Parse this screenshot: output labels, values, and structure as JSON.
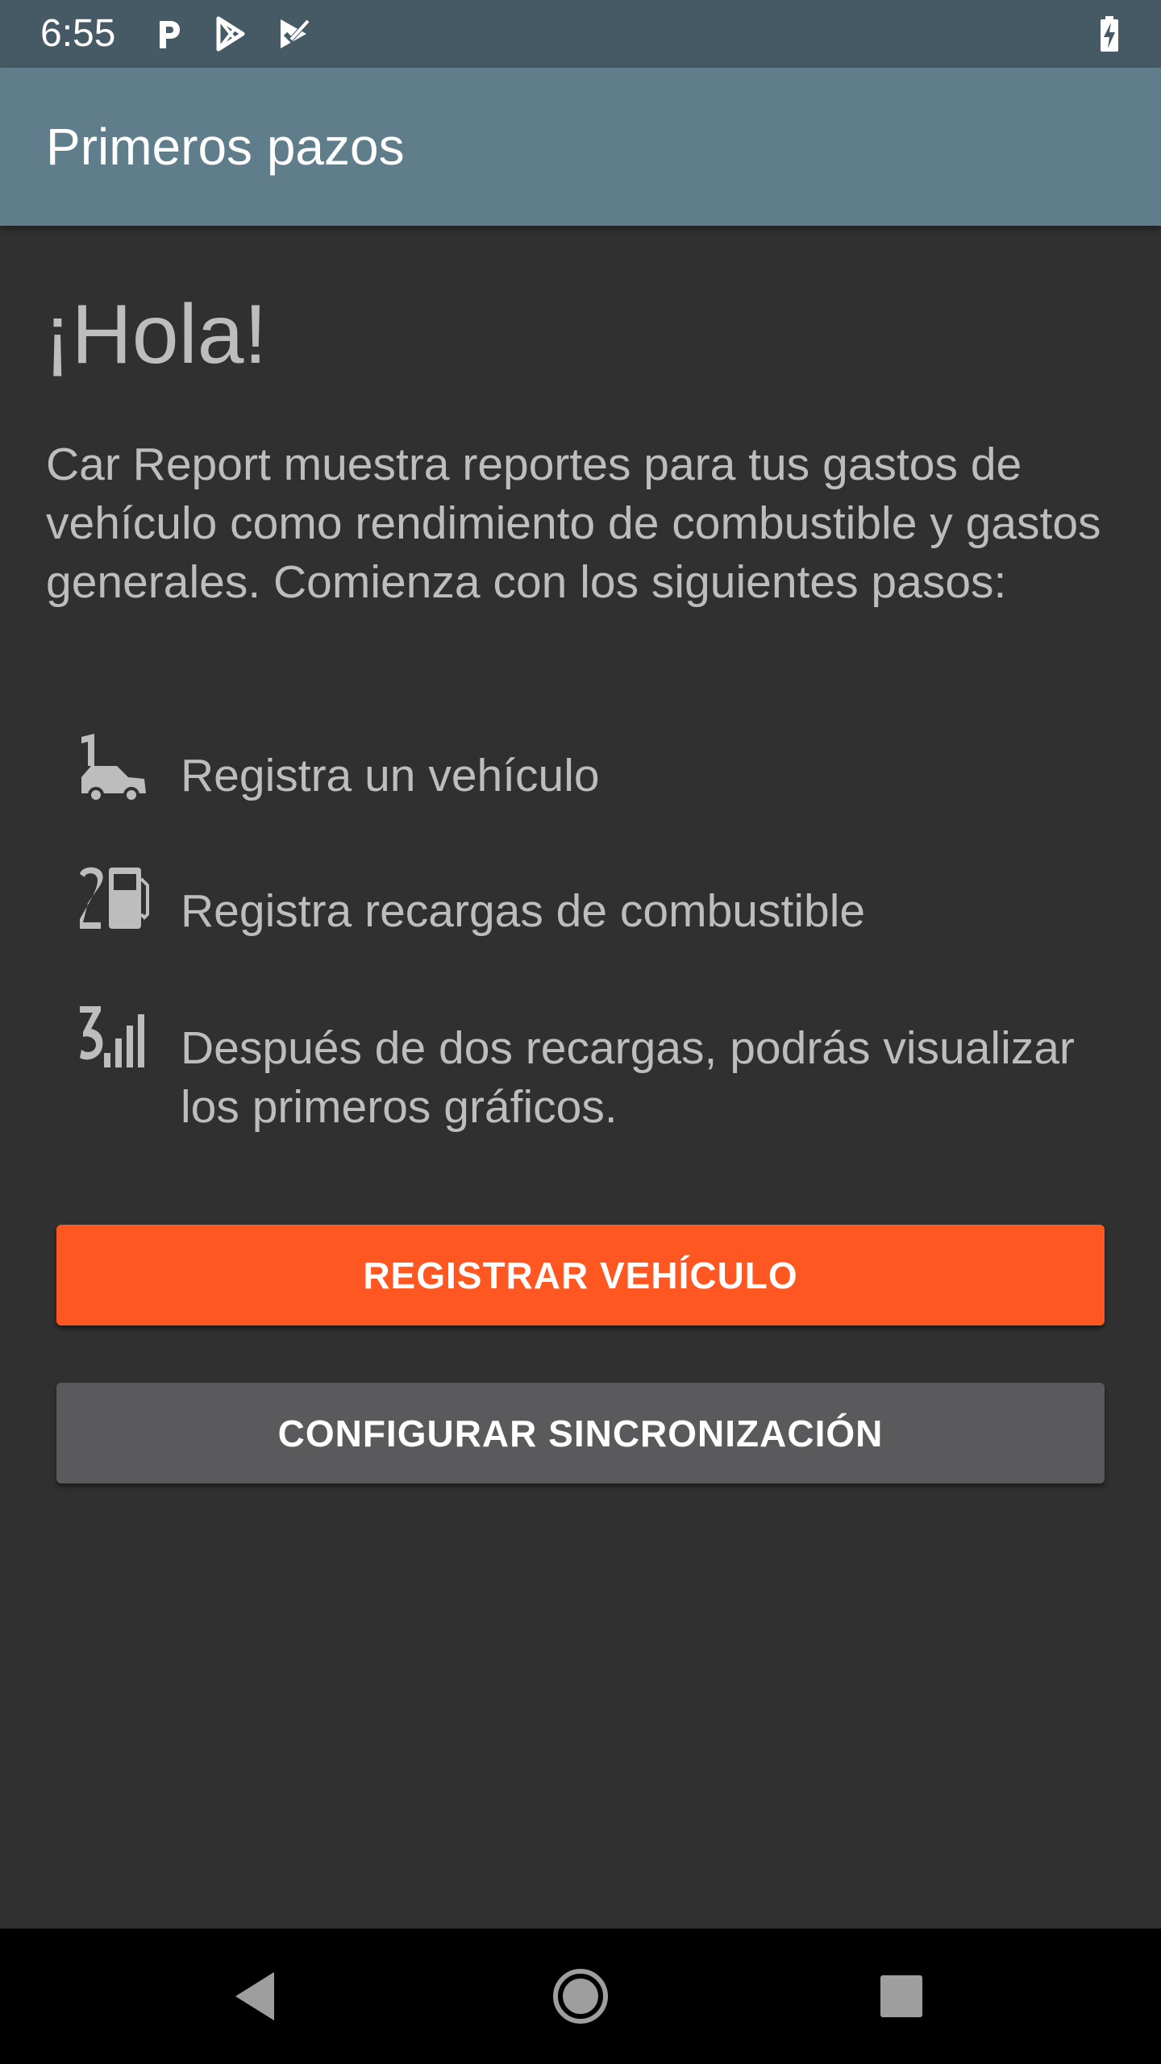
{
  "status_bar": {
    "time": "6:55",
    "icons": [
      "parking-app-icon",
      "play-store-icon",
      "tasks-check-icon",
      "battery-charging-icon"
    ]
  },
  "app_bar": {
    "title": "Primeros pazos"
  },
  "content": {
    "greeting": "¡Hola!",
    "intro": "Car Report muestra reportes para tus gastos de vehículo como rendimiento de combustible y gastos generales. Comienza con los siguientes pasos:",
    "steps": [
      {
        "icon": "step-1-car-icon",
        "label": "Registra un vehículo"
      },
      {
        "icon": "step-2-fuel-pump-icon",
        "label": "Registra recargas de combustible"
      },
      {
        "icon": "step-3-chart-icon",
        "label": "Después de dos recargas, podrás visualizar los primeros gráficos."
      }
    ]
  },
  "buttons": {
    "register_vehicle": "REGISTRAR VEHÍCULO",
    "configure_sync": "CONFIGURAR SINCRONIZACIÓN"
  },
  "nav_bar": {
    "icons": [
      "back-icon",
      "home-icon",
      "recents-icon"
    ]
  },
  "colors": {
    "status_bar": "#455a64",
    "app_bar": "#607d8b",
    "background": "#303030",
    "primary_button": "#ff5722",
    "secondary_button": "#5a5a5c",
    "text": "#bdbdbd"
  }
}
